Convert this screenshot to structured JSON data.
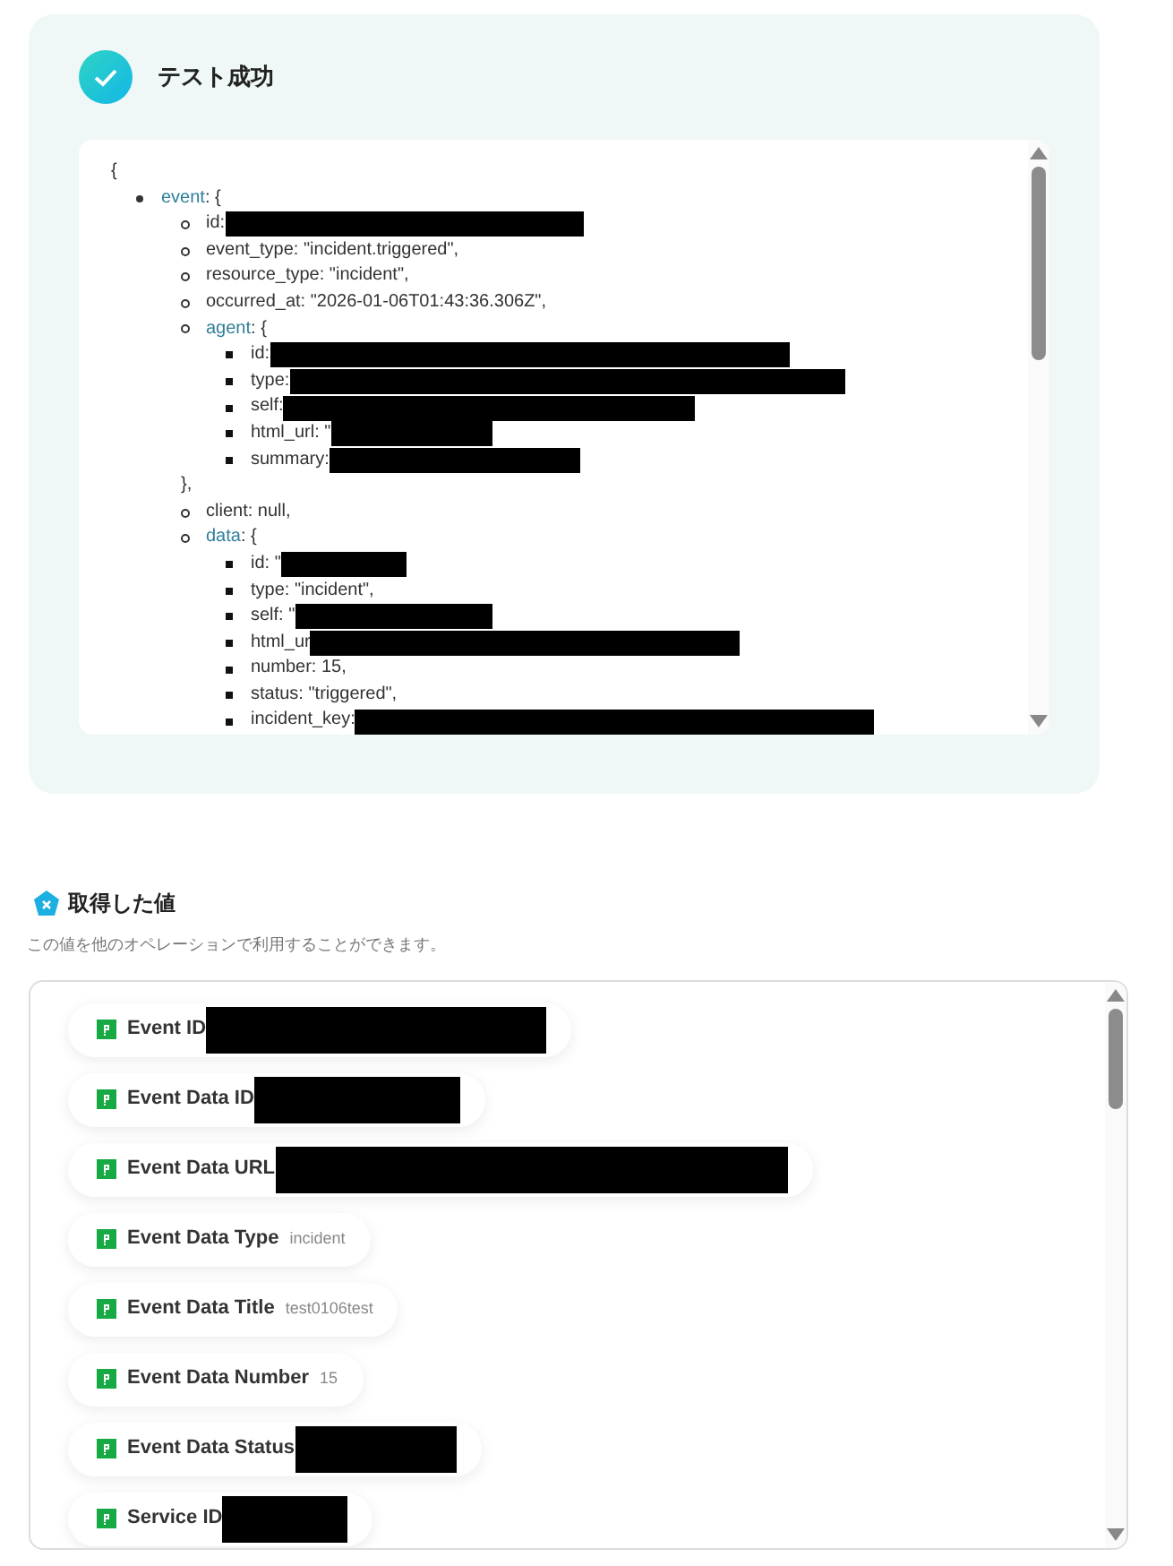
{
  "result": {
    "title": "テスト成功",
    "json_view": {
      "open": "{",
      "items": [
        {
          "kind": "object",
          "key": "event",
          "text": ": {",
          "children": [
            {
              "kind": "field",
              "text": "id:",
              "redacted": true
            },
            {
              "kind": "field",
              "text": "event_type: \"incident.triggered\",",
              "redacted": false
            },
            {
              "kind": "field",
              "text": "resource_type: \"incident\",",
              "redacted": false
            },
            {
              "kind": "field",
              "text": "occurred_at: \"2026-01-06T01:43:36.306Z\",",
              "redacted": false
            },
            {
              "kind": "object",
              "key": "agent",
              "text": ": {",
              "children": [
                {
                  "kind": "field",
                  "text": "id:",
                  "redacted": true
                },
                {
                  "kind": "field",
                  "text": "type:",
                  "redacted": true
                },
                {
                  "kind": "field",
                  "text": "self:",
                  "redacted": true
                },
                {
                  "kind": "field",
                  "text": "html_url: \"",
                  "redacted": true
                },
                {
                  "kind": "field",
                  "text": "summary:",
                  "redacted": true
                }
              ]
            },
            {
              "kind": "close",
              "text": "},"
            },
            {
              "kind": "field",
              "text": "client: null,",
              "redacted": false
            },
            {
              "kind": "object",
              "key": "data",
              "text": ": {",
              "children": [
                {
                  "kind": "field",
                  "text": "id: \"",
                  "redacted": true
                },
                {
                  "kind": "field",
                  "text": "type: \"incident\",",
                  "redacted": false
                },
                {
                  "kind": "field",
                  "text": "self: \"",
                  "redacted": true
                },
                {
                  "kind": "field",
                  "text": "html_ur",
                  "redacted": true
                },
                {
                  "kind": "field",
                  "text": "number: 15,",
                  "redacted": false
                },
                {
                  "kind": "field",
                  "text": "status: \"triggered\",",
                  "redacted": false
                },
                {
                  "kind": "field",
                  "text": "incident_key:",
                  "redacted": true
                }
              ]
            }
          ]
        }
      ]
    }
  },
  "outputs": {
    "title": "取得した値",
    "subtitle": "この値を他のオペレーションで利用することができます。",
    "items": [
      {
        "label": "Event ID",
        "redacted": true
      },
      {
        "label": "Event Data ID",
        "redacted": true
      },
      {
        "label": "Event Data URL",
        "redacted": true
      },
      {
        "label": "Event Data Type",
        "value": "incident",
        "redacted": false
      },
      {
        "label": "Event Data Title",
        "value": "test0106test",
        "redacted": false
      },
      {
        "label": "Event Data Number",
        "value": "15",
        "redacted": false
      },
      {
        "label": "Event Data Status",
        "redacted": true
      },
      {
        "label": "Service ID",
        "redacted": true
      }
    ]
  }
}
